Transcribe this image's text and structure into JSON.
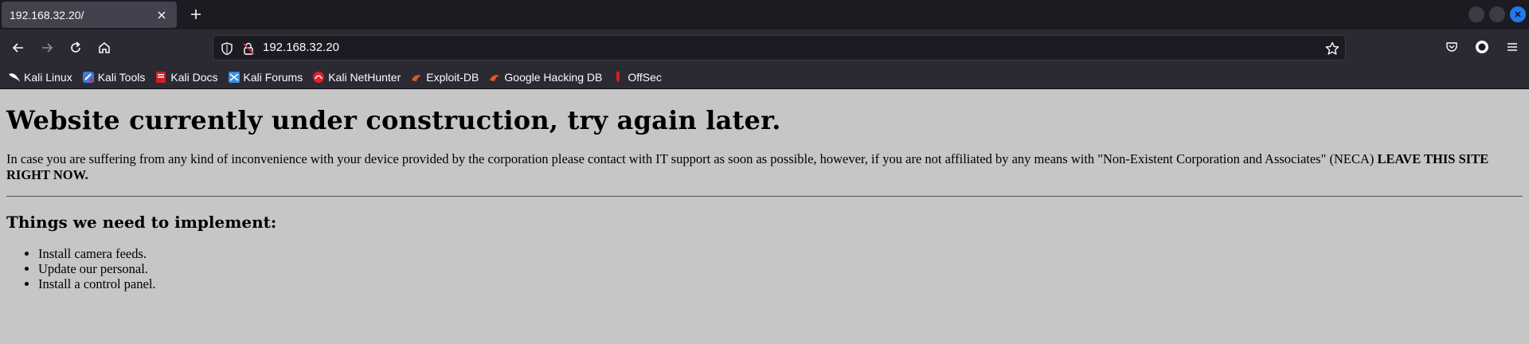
{
  "browser": {
    "tab": {
      "title": "192.168.32.20/"
    },
    "url": "192.168.32.20",
    "bookmarks": [
      {
        "label": "Kali Linux",
        "icon": "kali-dragon-icon",
        "color": "#ffffff"
      },
      {
        "label": "Kali Tools",
        "icon": "kali-tools-icon",
        "color": "#3d7bd9"
      },
      {
        "label": "Kali Docs",
        "icon": "kali-docs-icon",
        "color": "#d11f27"
      },
      {
        "label": "Kali Forums",
        "icon": "kali-forums-icon",
        "color": "#3a8de0"
      },
      {
        "label": "Kali NetHunter",
        "icon": "nethunter-icon",
        "color": "#e11f2a"
      },
      {
        "label": "Exploit-DB",
        "icon": "exploit-db-icon",
        "color": "#e3572b"
      },
      {
        "label": "Google Hacking DB",
        "icon": "ghdb-icon",
        "color": "#e3572b"
      },
      {
        "label": "OffSec",
        "icon": "offsec-icon",
        "color": "#d81f26"
      }
    ]
  },
  "page": {
    "heading": "Website currently under construction, try again later.",
    "intro": "In case you are suffering from any kind of inconvenience with your device provided by the corporation please contact with IT support as soon as possible, however, if you are not affiliated by any means with \"Non-Existent Corporation and Associates\" (NECA)",
    "intro_bold": "LEAVE THIS SITE RIGHT NOW.",
    "subheading": "Things we need to implement:",
    "items": [
      "Install camera feeds.",
      "Update our personal.",
      "Install a control panel."
    ]
  },
  "colors": {
    "tabstrip_bg": "#1c1b22",
    "toolbar_bg": "#2b2a33",
    "page_bg": "#c6c6c6",
    "accent_close": "#1f7aef"
  }
}
